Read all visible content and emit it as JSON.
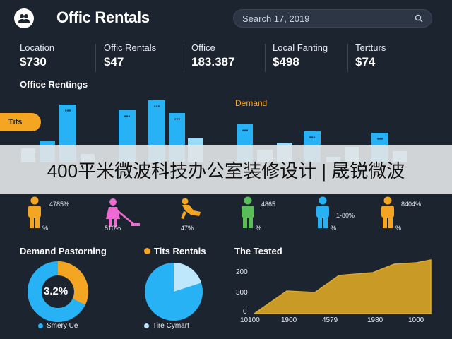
{
  "header": {
    "title": "Offic Rentals",
    "logo_icon": "people-icon",
    "search_text": "Search 17, 2019",
    "search_icon": "search-icon"
  },
  "stats": [
    {
      "label": "Location",
      "value": "$730"
    },
    {
      "label": "Offic Rentals",
      "value": "$47"
    },
    {
      "label": "Office",
      "value": "183.387"
    },
    {
      "label": "Local Fanting",
      "value": "$498"
    },
    {
      "label": "Tertturs",
      "value": "$74"
    }
  ],
  "office_rentings": {
    "title": "Office Rentings",
    "side_tab": "Tits",
    "demand_label": "Demand"
  },
  "banner": {
    "text": "400平米微波科技办公室装修设计 | 晟锐微波"
  },
  "people": [
    {
      "value": "4785%",
      "sub": "%",
      "icon": "person-icon",
      "color": "#f4a623"
    },
    {
      "value": "",
      "sub": "510%",
      "icon": "person-cleaning-icon",
      "color": "#f06bd1"
    },
    {
      "value": "",
      "sub": "47%",
      "icon": "running-person-icon",
      "color": "#f4a623"
    },
    {
      "value": "4865",
      "sub": "%",
      "icon": "person-icon",
      "color": "#5bbd5a"
    },
    {
      "value": "1-80%",
      "sub": "%",
      "icon": "person-icon",
      "color": "#27b2f5"
    },
    {
      "value": "8404%",
      "sub": "%",
      "icon": "person-icon",
      "color": "#f4a623"
    }
  ],
  "demand_pastorning": {
    "title": "Demand Pastorning",
    "donut_value": "3.2%",
    "legend": "Smery Ue",
    "fraction": 0.32
  },
  "tits_rentals": {
    "title": "Tits Rentals",
    "legend": "Tire Cymart",
    "fraction": 0.2
  },
  "the_tested": {
    "title": "The Tested",
    "y_ticks": [
      "200",
      "300",
      "0"
    ],
    "x_ticks": [
      "10100",
      "1900",
      "4579",
      "1980",
      "1000"
    ]
  },
  "colors": {
    "background": "#1c2430",
    "accent_blue": "#27b2f5",
    "accent_orange": "#f4a623",
    "area_gold": "#c99a26"
  }
}
